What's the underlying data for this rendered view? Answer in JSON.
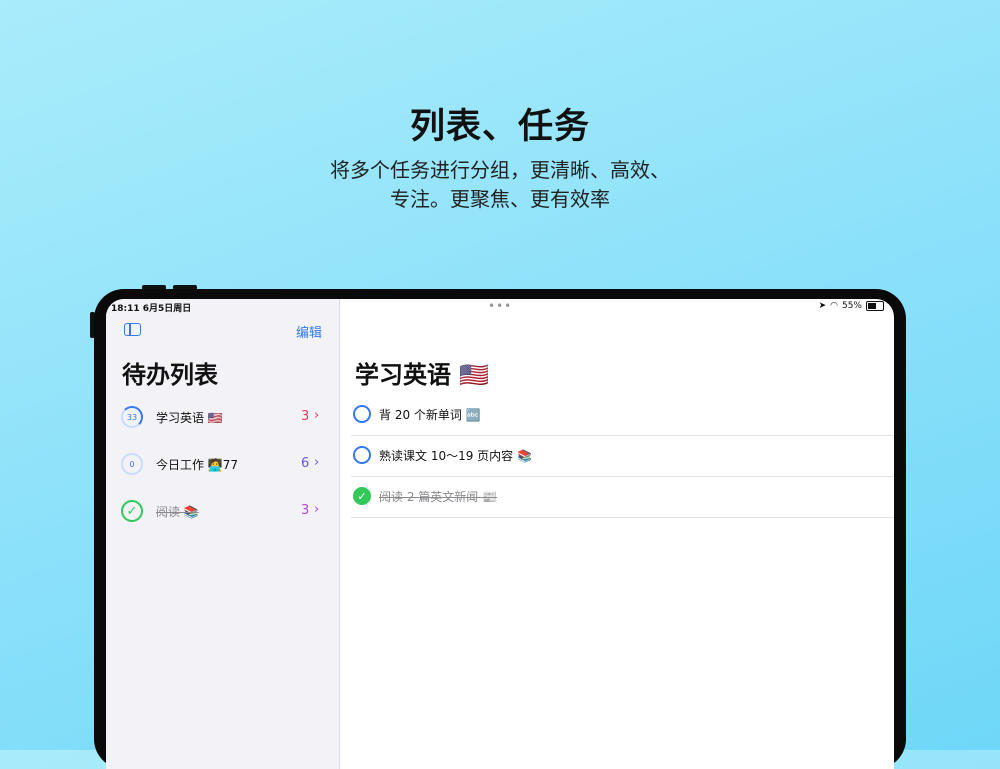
{
  "promo": {
    "headline": "列表、任务",
    "subline": "将多个任务进行分组，更清晰、高效、专注。更聚焦、更有效率"
  },
  "status_bar": {
    "time": "18:11  6月5日周日",
    "battery": "55%",
    "battery_level": 0.55,
    "more": "•••"
  },
  "sidebar": {
    "edit_label": "编辑",
    "title": "待办列表",
    "items": [
      {
        "ring_text": "33",
        "label": "学习英语 🇺🇸",
        "count": "3",
        "chevron": "›",
        "color": "#e0405a",
        "state": "partial"
      },
      {
        "ring_text": "0",
        "label": "今日工作 🧑‍💻77",
        "count": "6",
        "chevron": "›",
        "color": "#6a55d6",
        "state": "empty"
      },
      {
        "ring_text": "✓",
        "label": "阅读 📚",
        "count": "3",
        "chevron": "›",
        "color": "#b347d6",
        "state": "done"
      }
    ]
  },
  "detail": {
    "title": "学习英语 🇺🇸",
    "tasks": [
      {
        "text": "背 20 个新单词 🔤",
        "done": false,
        "check": ""
      },
      {
        "text": "熟读课文 10～19 页内容 📚",
        "done": false,
        "check": ""
      },
      {
        "text": "阅读 2 篇英文新闻 📰",
        "done": true,
        "check": "✓"
      }
    ]
  },
  "colors": {
    "accent": "#3478f6",
    "done_green": "#34c759"
  }
}
